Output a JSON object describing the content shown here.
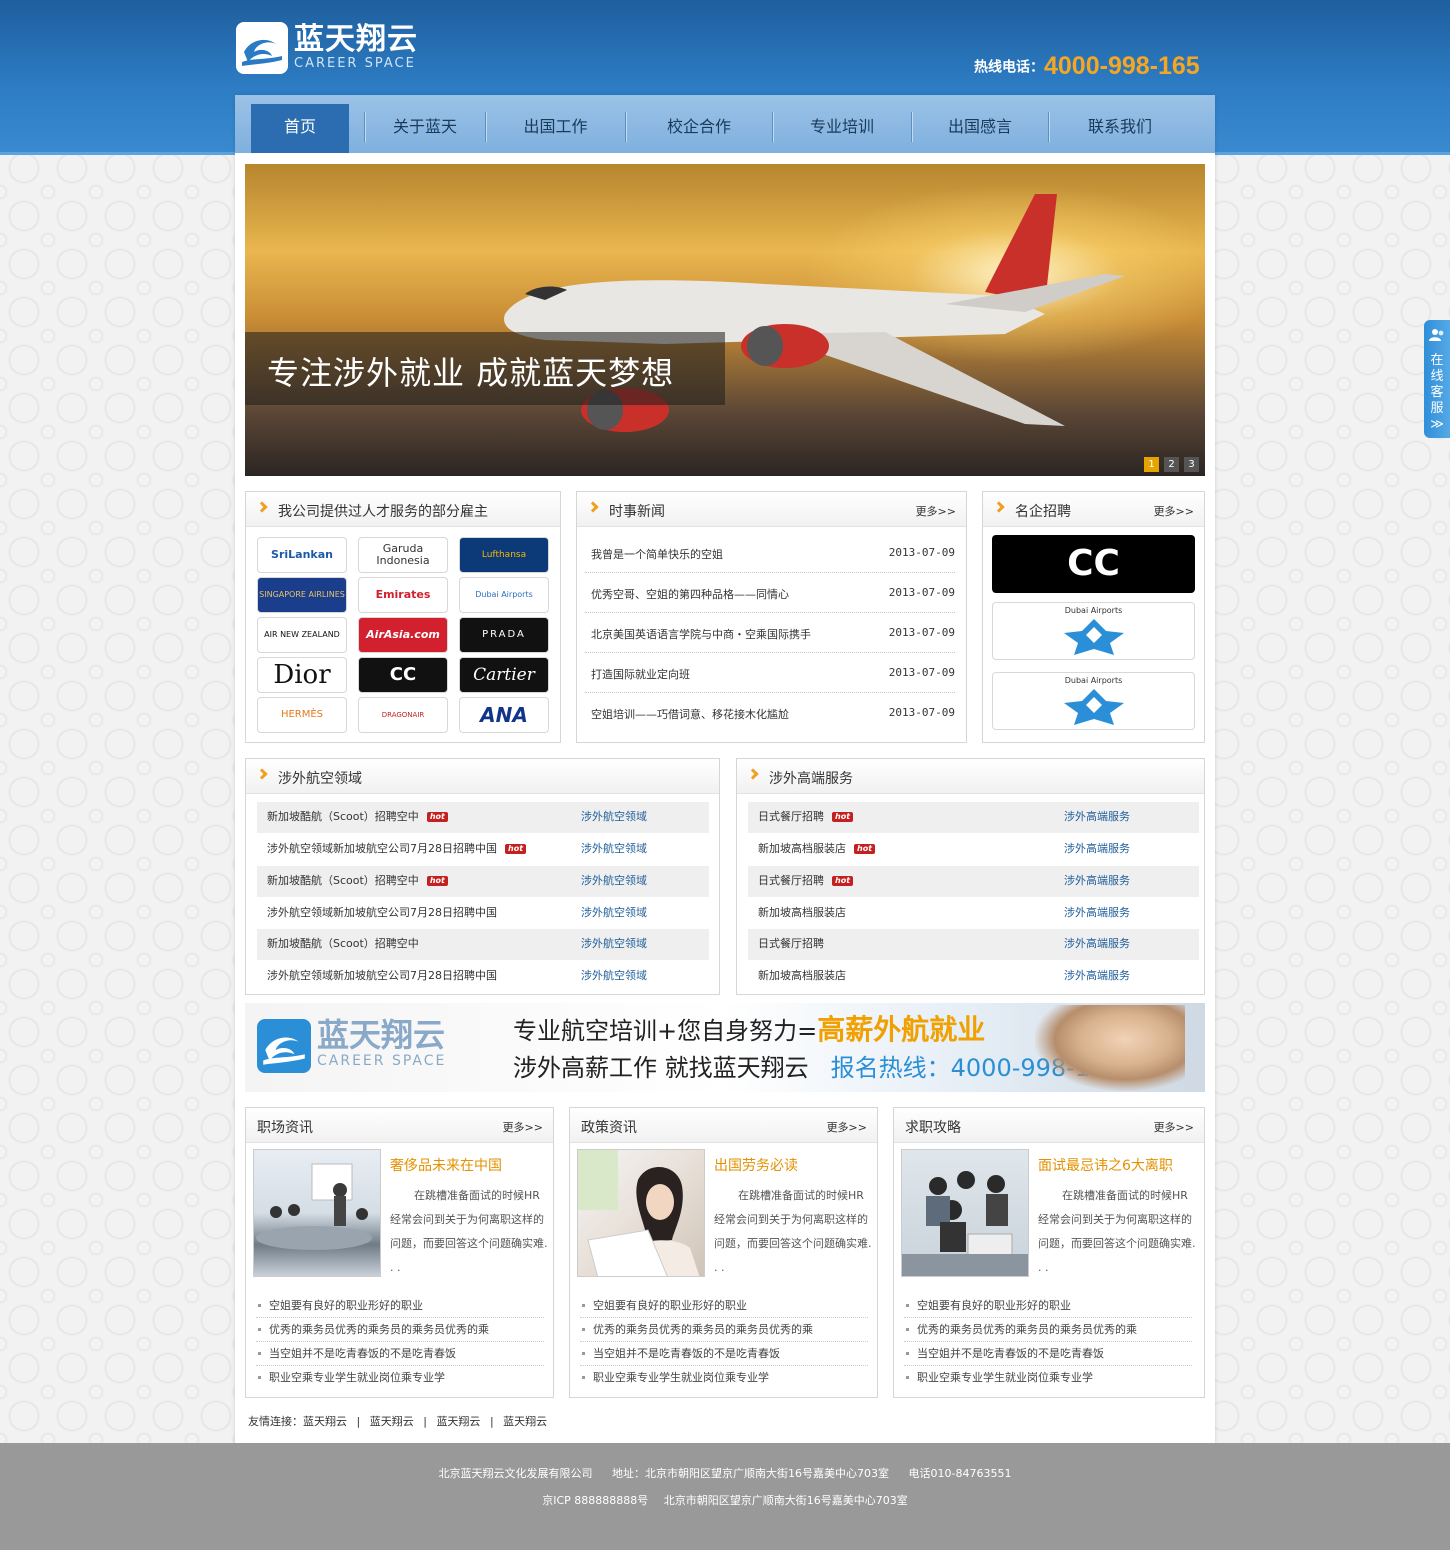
{
  "header": {
    "logo_cn": "蓝天翔云",
    "logo_en": "CAREER SPACE",
    "hotline_label": "热线电话：",
    "hotline_number": "4000-998-165"
  },
  "nav": {
    "items": [
      {
        "label": "首页"
      },
      {
        "label": "关于蓝天"
      },
      {
        "label": "出国工作"
      },
      {
        "label": "校企合作"
      },
      {
        "label": "专业培训"
      },
      {
        "label": "出国感言"
      },
      {
        "label": "联系我们"
      }
    ]
  },
  "banner": {
    "text": "专注涉外就业  成就蓝天梦想",
    "pages": [
      "1",
      "2",
      "3"
    ]
  },
  "employers": {
    "title": "我公司提供过人才服务的部分雇主",
    "logos": [
      "SriLankan",
      "Garuda Indonesia",
      "Lufthansa",
      "SINGAPORE AIRLINES",
      "Emirates",
      "Dubai Airports",
      "AIR NEW ZEALAND",
      "AirAsia.com",
      "PRADA",
      "Dior",
      "CC",
      "Cartier",
      "HERMÈS",
      "DRAGONAIR",
      "ANA"
    ]
  },
  "news": {
    "title": "时事新闻",
    "more": "更多>>",
    "items": [
      {
        "title": "我曾是一个简单快乐的空姐",
        "date": "2013-07-09"
      },
      {
        "title": "优秀空哥、空姐的第四种品格——同情心",
        "date": "2013-07-09"
      },
      {
        "title": "北京美国英语语言学院与中商・空乘国际携手",
        "date": "2013-07-09"
      },
      {
        "title": "打造国际就业定向班",
        "date": "2013-07-09"
      },
      {
        "title": "空姐培训——巧借词意、移花接木化尴尬",
        "date": "2013-07-09"
      }
    ]
  },
  "recruit": {
    "title": "名企招聘",
    "more": "更多>>",
    "logos": [
      "CC",
      "Dubai Airports",
      "Dubai Airports"
    ]
  },
  "aviation": {
    "title": "涉外航空领域",
    "hot_label": "hot",
    "rows": [
      {
        "title": "新加坡酷航（Scoot）招聘空中",
        "hot": true,
        "category": "涉外航空领域"
      },
      {
        "title": "涉外航空领域新加坡航空公司7月28日招聘中国",
        "hot": true,
        "category": "涉外航空领域"
      },
      {
        "title": "新加坡酷航（Scoot）招聘空中",
        "hot": true,
        "category": "涉外航空领域"
      },
      {
        "title": "涉外航空领域新加坡航空公司7月28日招聘中国",
        "hot": false,
        "category": "涉外航空领域"
      },
      {
        "title": "新加坡酷航（Scoot）招聘空中",
        "hot": false,
        "category": "涉外航空领域"
      },
      {
        "title": "涉外航空领域新加坡航空公司7月28日招聘中国",
        "hot": false,
        "category": "涉外航空领域"
      }
    ]
  },
  "services": {
    "title": "涉外高端服务",
    "rows": [
      {
        "title": "日式餐厅招聘",
        "hot": true,
        "category": "涉外高端服务"
      },
      {
        "title": "新加坡高档服装店",
        "hot": true,
        "category": "涉外高端服务"
      },
      {
        "title": "日式餐厅招聘",
        "hot": true,
        "category": "涉外高端服务"
      },
      {
        "title": "新加坡高档服装店",
        "hot": false,
        "category": "涉外高端服务"
      },
      {
        "title": "日式餐厅招聘",
        "hot": false,
        "category": "涉外高端服务"
      },
      {
        "title": "新加坡高档服装店",
        "hot": false,
        "category": "涉外高端服务"
      }
    ]
  },
  "ad": {
    "logo_cn": "蓝天翔云",
    "logo_en": "CAREER SPACE",
    "line1_a": "专业航空培训+您自身努力=",
    "line1_b": "高薪外航就业",
    "line2_a": "涉外高薪工作 就找蓝天翔云",
    "line2_b": "报名热线：4000-998-165"
  },
  "columns": [
    {
      "title": "职场资讯",
      "more": "更多>>",
      "article_title": "奢侈品未来在中国",
      "article_desc": "在跳槽准备面试的时候HR经常会问到关于为何离职这样的问题，而要回答这个问题确实难. . .",
      "items": [
        "空姐要有良好的职业形好的职业",
        "优秀的乘务员优秀的乘务员的乘务员优秀的乘",
        "当空姐并不是吃青春饭的不是吃青春饭",
        "职业空乘专业学生就业岗位乘专业学"
      ]
    },
    {
      "title": "政策资讯",
      "more": "更多>>",
      "article_title": "出国劳务必读",
      "article_desc": "在跳槽准备面试的时候HR经常会问到关于为何离职这样的问题，而要回答这个问题确实难. . .",
      "items": [
        "空姐要有良好的职业形好的职业",
        "优秀的乘务员优秀的乘务员的乘务员优秀的乘",
        "当空姐并不是吃青春饭的不是吃青春饭",
        "职业空乘专业学生就业岗位乘专业学"
      ]
    },
    {
      "title": "求职攻略",
      "more": "更多>>",
      "article_title": "面试最忌讳之6大离职",
      "article_desc": "在跳槽准备面试的时候HR经常会问到关于为何离职这样的问题，而要回答这个问题确实难. . .",
      "items": [
        "空姐要有良好的职业形好的职业",
        "优秀的乘务员优秀的乘务员的乘务员优秀的乘",
        "当空姐并不是吃青春饭的不是吃青春饭",
        "职业空乘专业学生就业岗位乘专业学"
      ]
    }
  ],
  "links": {
    "label": "友情连接：",
    "items": [
      "蓝天翔云",
      "蓝天翔云",
      "蓝天翔云",
      "蓝天翔云"
    ],
    "separator": "|"
  },
  "footer": {
    "company": "北京蓝天翔云文化发展有限公司",
    "address": "地址：北京市朝阳区望京广顺南大街16号嘉美中心703室",
    "phone": "电话010-84763551",
    "icp": "京ICP 888888888号",
    "address2": "北京市朝阳区望京广顺南大街16号嘉美中心703室"
  },
  "online_service": {
    "label": "在线客服",
    "arrow": "≫"
  },
  "colors": {
    "header_blue": "#2e7ec6",
    "nav_active": "#2b6db0",
    "accent_orange": "#f5a623",
    "link_blue": "#1d5e98"
  }
}
